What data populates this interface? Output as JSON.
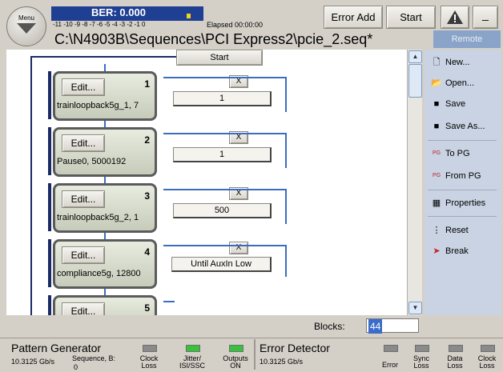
{
  "header": {
    "menu_label": "Menu",
    "ber": "BER: 0.000",
    "ber_scale": "-11 -10 -9  -8  -7  -6  -5  -4  -3  -2  -1  0",
    "elapsed": "Elapsed 00:00:00",
    "error_add": "Error Add",
    "start": "Start",
    "minimize": "_",
    "path": "C:\\N4903B\\Sequences\\PCI Express2\\pcie_2.seq*",
    "remote": "Remote"
  },
  "sequence": {
    "start_label": "Start",
    "blocks": [
      {
        "edit": "Edit...",
        "num": "1",
        "name": "trainloopback5g_1, 7",
        "loop": "1",
        "x": "X"
      },
      {
        "edit": "Edit...",
        "num": "2",
        "name": "Pause0, 5000192",
        "loop": "1",
        "x": "X"
      },
      {
        "edit": "Edit...",
        "num": "3",
        "name": "trainloopback5g_2, 1",
        "loop": "500",
        "x": "X"
      },
      {
        "edit": "Edit...",
        "num": "4",
        "name": "compliance5g, 12800",
        "loop": "Until AuxIn Low",
        "x": "X"
      },
      {
        "edit": "Edit...",
        "num": "5"
      }
    ],
    "blocks_label": "Blocks:",
    "blocks_value": "44"
  },
  "side": {
    "new": "New...",
    "open": "Open...",
    "save": "Save",
    "save_as": "Save As...",
    "to_pg": "To PG",
    "from_pg": "From PG",
    "properties": "Properties",
    "reset": "Reset",
    "break": "Break"
  },
  "status": {
    "pg_title": "Pattern Generator",
    "pg_rate": "10.3125 Gb/s",
    "seq_b": "Sequence, B:",
    "seq_b_val": "0",
    "clock_loss": "Clock\nLoss",
    "jitter": "Jitter/\nISI/SSC",
    "outputs": "Outputs\nON",
    "ed_title": "Error Detector",
    "ed_rate": "10.3125 Gb/s",
    "error": "Error",
    "sync_loss": "Sync\nLoss",
    "data_loss": "Data\nLoss",
    "ed_clock_loss": "Clock\nLoss"
  },
  "colors": {
    "ber_bg": "#1f3f93",
    "wire": "#3b6dbf",
    "side_bg": "#c9d3e3",
    "led_green": "#36c23a",
    "led_grey": "#8a8a8a"
  }
}
